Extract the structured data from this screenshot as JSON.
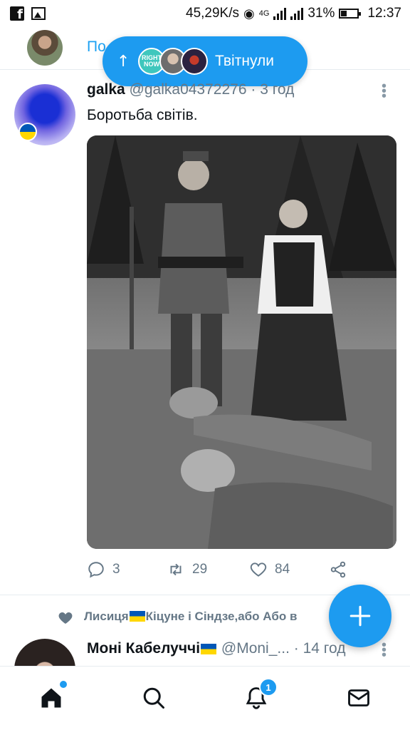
{
  "status_bar": {
    "network_speed": "45,29K/s",
    "network_type": "4G",
    "battery": "31%",
    "time": "12:37",
    "icons": [
      "facebook-icon",
      "gallery-icon",
      "hotspot-icon",
      "signal-icon",
      "battery-icon"
    ]
  },
  "top_bar": {
    "title": "По",
    "new_tweets_pill": {
      "avatar_text": "RIGHT NOW",
      "label": "Твітнули",
      "icon": "arrow-up-icon"
    }
  },
  "tweet": {
    "name": "galka",
    "handle": "@galka04372276",
    "separator": "·",
    "time": "3 год",
    "text": "Боротьба світів.",
    "actions": {
      "replies": "3",
      "retweets": "29",
      "likes": "84"
    }
  },
  "next_tweet": {
    "liked_by_name_part1": "Лисиця",
    "liked_by_name_part2": "Кіцуне і Сіндзе,або Або в",
    "name": "Моні Кабелуччі",
    "handle": "@Moni_...",
    "separator": "·",
    "time": "14 год"
  },
  "bottom_nav": {
    "notifications_badge": "1",
    "items": [
      "home-icon",
      "search-icon",
      "notifications-icon",
      "messages-icon"
    ]
  },
  "colors": {
    "accent": "#1d9bf0",
    "secondary_text": "#657786",
    "ukraine_blue": "#0057b7",
    "ukraine_yellow": "#ffd700"
  }
}
